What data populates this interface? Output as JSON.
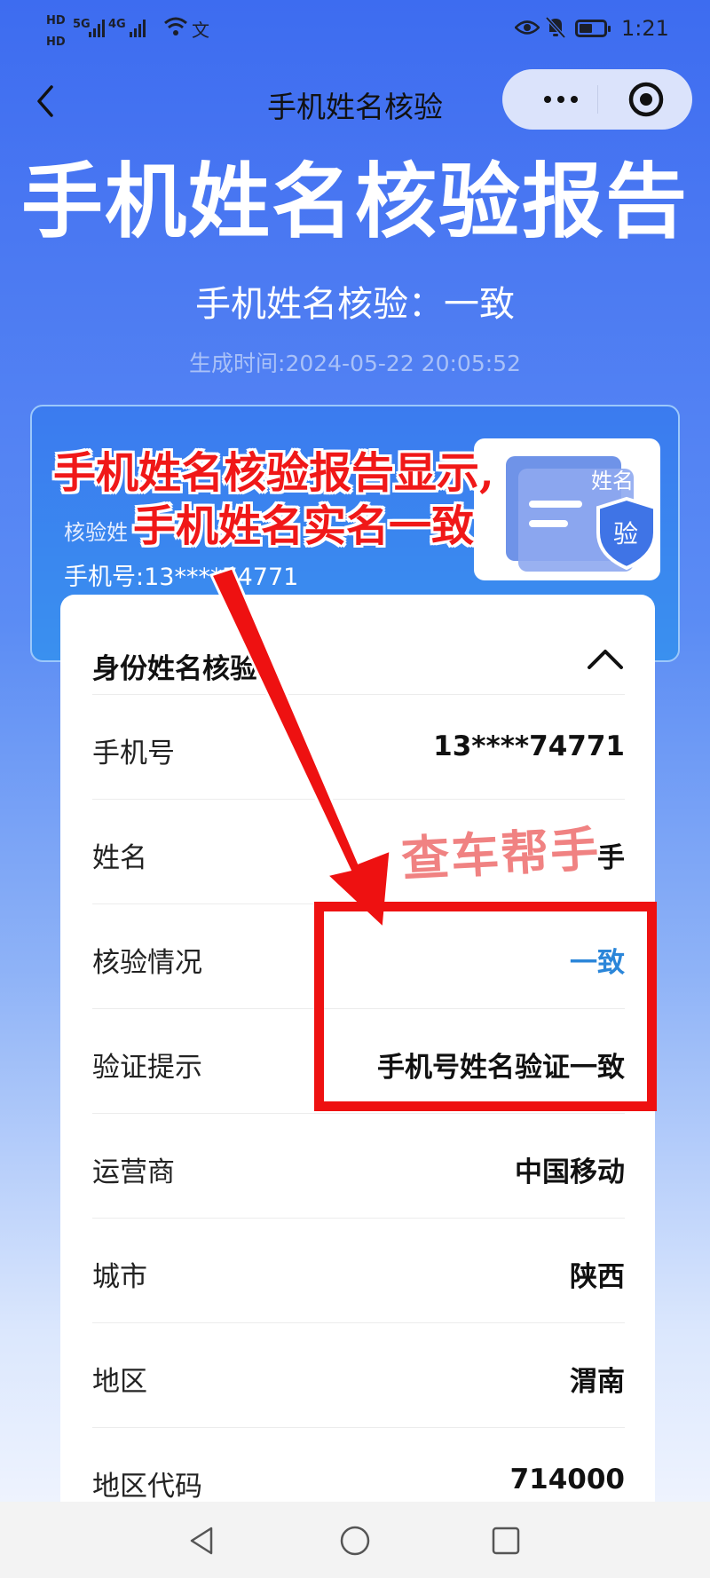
{
  "status_bar": {
    "hd1": "HD",
    "hd2": "HD",
    "net1": "5G",
    "net2": "4G",
    "extra": "文",
    "time": "1:21"
  },
  "nav": {
    "title": "手机姓名核验"
  },
  "report": {
    "title": "手机姓名核验报告",
    "subtitle": "手机姓名核验：一致",
    "generated": "生成时间:2024-05-22 20:05:52"
  },
  "info_card": {
    "name_label": "核验姓",
    "phone": "手机号:13****74771",
    "badge_text": "姓名",
    "badge_shield": "验"
  },
  "panel": {
    "heading": "身份姓名核验",
    "rows": [
      {
        "label": "手机号",
        "value": "13****74771"
      },
      {
        "label": "姓名",
        "value": "手"
      },
      {
        "label": "核验情况",
        "value": "一致"
      },
      {
        "label": "验证提示",
        "value": "手机号姓名验证一致"
      },
      {
        "label": "运营商",
        "value": "中国移动"
      },
      {
        "label": "城市",
        "value": "陕西"
      },
      {
        "label": "地区",
        "value": "渭南"
      },
      {
        "label": "地区代码",
        "value": "714000"
      }
    ]
  },
  "annotation": {
    "caption_line1": "手机姓名核验报告显示,",
    "caption_line2": "手机姓名实名一致",
    "watermark": "查车帮手",
    "highlight_color": "#ee1111"
  },
  "colors": {
    "header_blue": "#3d6cf0",
    "accent_value": "#2b86d9"
  }
}
